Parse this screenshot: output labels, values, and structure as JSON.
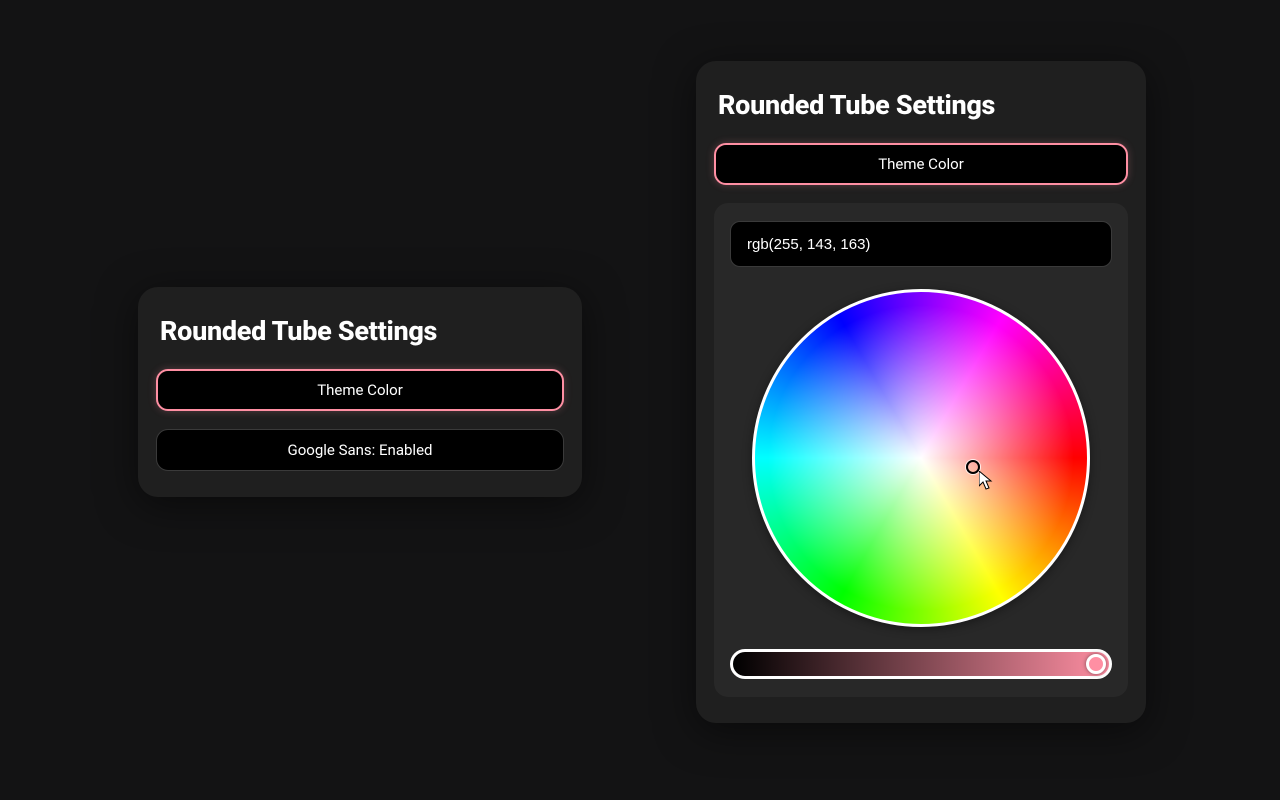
{
  "accent_color": "#ff8fa3",
  "left_panel": {
    "title": "Rounded Tube Settings",
    "theme_button_label": "Theme Color",
    "font_button_label": "Google Sans: Enabled"
  },
  "right_panel": {
    "title": "Rounded Tube Settings",
    "theme_button_label": "Theme Color",
    "color_value": "rgb(255, 143, 163)"
  }
}
